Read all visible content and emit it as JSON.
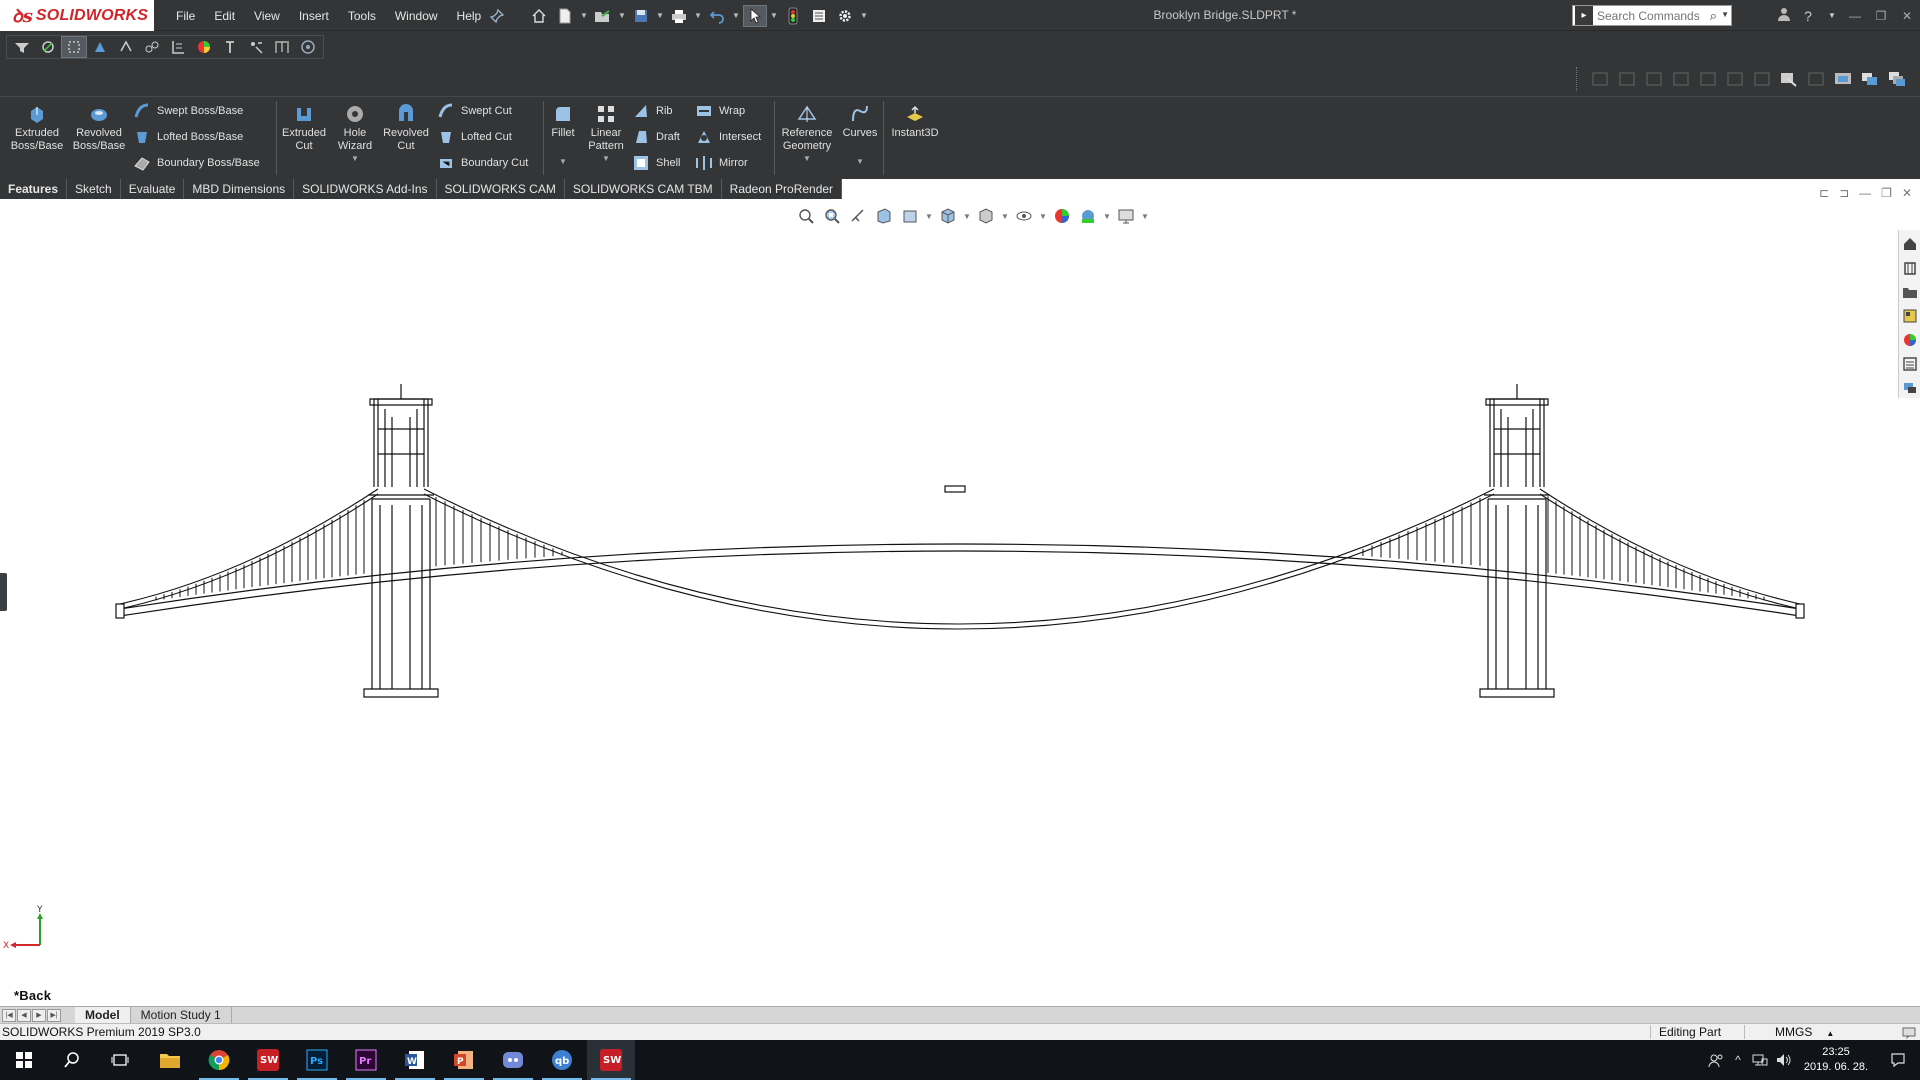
{
  "app": {
    "brand": "SOLIDWORKS",
    "window_title": "Brooklyn Bridge.SLDPRT *"
  },
  "menu": {
    "items": [
      "File",
      "Edit",
      "View",
      "Insert",
      "Tools",
      "Window",
      "Help"
    ]
  },
  "search": {
    "placeholder": "Search Commands"
  },
  "command_manager": {
    "extruded_boss": "Extruded\nBoss/Base",
    "revolved_boss": "Revolved\nBoss/Base",
    "swept_boss": "Swept Boss/Base",
    "lofted_boss": "Lofted Boss/Base",
    "boundary_boss": "Boundary Boss/Base",
    "extruded_cut": "Extruded\nCut",
    "hole_wizard": "Hole\nWizard",
    "revolved_cut": "Revolved\nCut",
    "swept_cut": "Swept Cut",
    "lofted_cut": "Lofted Cut",
    "boundary_cut": "Boundary Cut",
    "fillet": "Fillet",
    "linear_pattern": "Linear\nPattern",
    "rib": "Rib",
    "draft": "Draft",
    "shell": "Shell",
    "wrap": "Wrap",
    "intersect": "Intersect",
    "mirror": "Mirror",
    "reference_geometry": "Reference\nGeometry",
    "curves": "Curves",
    "instant3d": "Instant3D"
  },
  "tabs": [
    "Features",
    "Sketch",
    "Evaluate",
    "MBD Dimensions",
    "SOLIDWORKS Add-Ins",
    "SOLIDWORKS CAM",
    "SOLIDWORKS CAM TBM",
    "Radeon ProRender"
  ],
  "viewport": {
    "view_label": "*Back",
    "triad_y": "Y",
    "triad_x": "X"
  },
  "model_tabs": [
    "Model",
    "Motion Study 1"
  ],
  "status": {
    "product": "SOLIDWORKS Premium 2019 SP3.0",
    "mode": "Editing Part",
    "units": "MMGS"
  },
  "clock": {
    "time": "23:25",
    "date": "2019. 06. 28."
  },
  "colors": {
    "chrome": "#333537",
    "brand_red": "#d1252a",
    "taskbar": "#101418"
  }
}
